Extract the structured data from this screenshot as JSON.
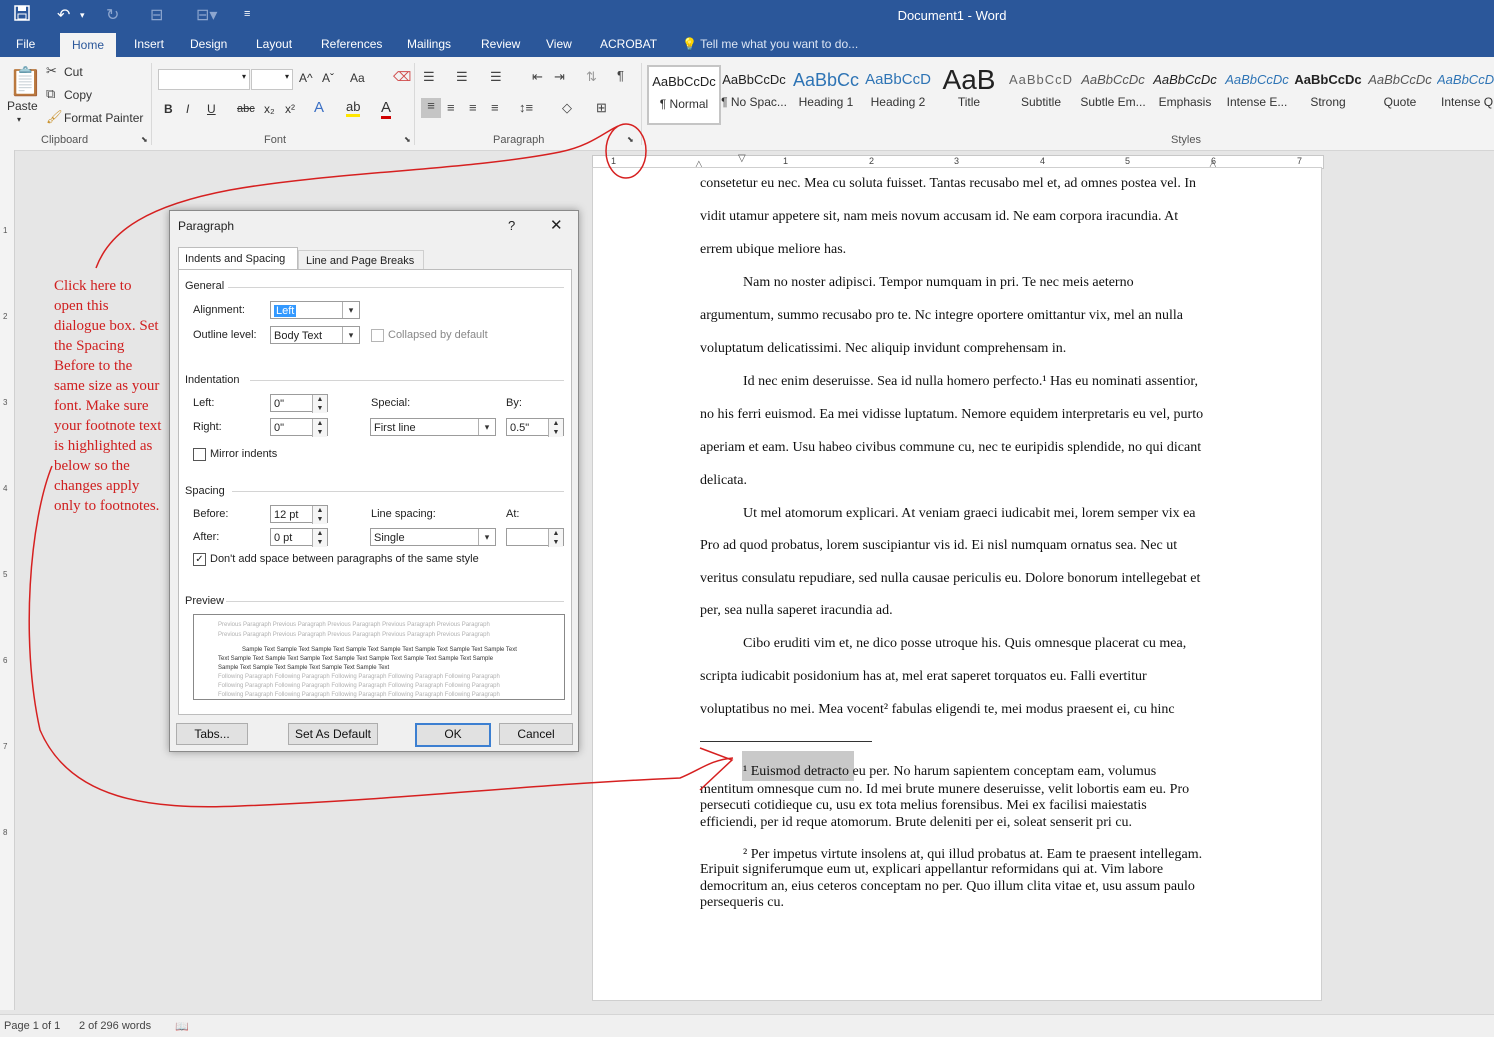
{
  "window": {
    "title": "Document1 - Word",
    "qat_icons": [
      "save-icon",
      "undo-icon",
      "redo-icon",
      "customize-qat-icon"
    ]
  },
  "ribbon_tabs": [
    "File",
    "Home",
    "Insert",
    "Design",
    "Layout",
    "References",
    "Mailings",
    "Review",
    "View",
    "ACROBAT"
  ],
  "active_tab": "Home",
  "tell_me": "Tell me what you want to do...",
  "clipboard": {
    "paste": "Paste",
    "cut": "Cut",
    "copy": "Copy",
    "format_painter": "Format Painter",
    "label": "Clipboard"
  },
  "font_group": {
    "font_name": "",
    "font_size": "",
    "label": "Font",
    "bold": "B",
    "italic": "I",
    "underline": "U",
    "strike": "abc",
    "subscript": "x₂",
    "superscript": "x²",
    "grow": "A^",
    "shrink": "Aˇ",
    "change_case": "Aa"
  },
  "paragraph_group": {
    "label": "Paragraph"
  },
  "styles_group": {
    "label": "Styles",
    "items": [
      {
        "preview": "AaBbCcDc",
        "name": "¶ Normal"
      },
      {
        "preview": "AaBbCcDc",
        "name": "¶ No Spac..."
      },
      {
        "preview": "AaBbCc",
        "name": "Heading 1"
      },
      {
        "preview": "AaBbCcD",
        "name": "Heading 2"
      },
      {
        "preview": "AaB",
        "name": "Title"
      },
      {
        "preview": "AaBbCcD",
        "name": "Subtitle"
      },
      {
        "preview": "AaBbCcDc",
        "name": "Subtle Em..."
      },
      {
        "preview": "AaBbCcDc",
        "name": "Emphasis"
      },
      {
        "preview": "AaBbCcDc",
        "name": "Intense E..."
      },
      {
        "preview": "AaBbCcDc",
        "name": "Strong"
      },
      {
        "preview": "AaBbCcDc",
        "name": "Quote"
      },
      {
        "preview": "AaBbCcDc",
        "name": "Intense Q..."
      }
    ]
  },
  "ruler": {
    "labels": [
      "1",
      "1",
      "2",
      "3",
      "4",
      "5",
      "6",
      "7"
    ]
  },
  "vertical_ruler": {
    "labels": [
      "1",
      "2",
      "3",
      "4",
      "5",
      "6",
      "7",
      "8"
    ]
  },
  "document": {
    "body_lines": [
      "consetetur eu nec. Mea cu soluta fuisset. Tantas recusabo mel et, ad omnes postea vel. In",
      "vidit utamur appetere sit, nam meis novum accusam id. Ne eam corpora iracundia. At",
      "errem ubique meliore has.",
      "Nam no noster adipisci. Tempor numquam in pri. Te nec meis aeterno",
      "argumentum, summo recusabo pro te. Nc integre oportere omittantur vix, mel an nulla",
      "voluptatum delicatissimi. Nec aliquip invidunt comprehensam in.",
      "Id nec enim deseruisse. Sea id nulla homero perfecto.¹ Has eu nominati assentior,",
      "no his ferri euismod. Ea mei vidisse luptatum. Nemore equidem interpretaris eu vel, purto",
      "aperiam et eam. Usu habeo civibus commune cu, nec te euripidis splendide, no qui dicant",
      "delicata.",
      "Ut mel atomorum explicari. At veniam graeci iudicabit mei, lorem semper vix ea",
      "Pro ad quod probatus, lorem suscipiantur vis id. Ei nisl numquam ornatus sea. Nec ut",
      "veritus consulatu repudiare, sed nulla causae periculis eu. Dolore bonorum intellegebat et",
      "per, sea nulla saperet iracundia ad.",
      "Cibo eruditi vim et, ne dico posse utroque his. Quis omnesque placerat cu mea,",
      "scripta iudicabit posidonium has at, mel erat saperet torquatos eu. Falli evertitur",
      "voluptatibus no mei. Mea vocent² fabulas eligendi te, mei modus praesent ei, cu hinc"
    ],
    "footnote1_lines": [
      "¹ Euismod detracto eu per. No harum sapientem conceptam eam, volumus",
      "mentitum omnesque cum no. Id mei brute munere deseruisse, velit lobortis eam eu. Pro",
      "persecuti cotidieque cu, usu ex tota melius forensibus. Mei ex facilisi maiestatis",
      "efficiendi, per id reque atomorum. Brute deleniti per ei, soleat senserit pri cu."
    ],
    "footnote2_lines": [
      "² Per impetus virtute insolens at, qui illud probatus at. Eam te praesent intellegam.",
      "Eripuit signiferumque eum ut, explicari appellantur reformidans qui at. Vim labore",
      "democritum an, eius ceteros conceptam no per. Quo illum clita vitae et, usu assum paulo",
      "persequeris cu."
    ]
  },
  "annotation": {
    "lines": [
      "Click here to",
      "open this",
      "dialogue box. Set",
      "the Spacing",
      "Before to the",
      "same size as your",
      "font. Make sure",
      "your footnote text",
      "is highlighted as",
      "below so the",
      "changes apply",
      "only to footnotes."
    ],
    "color": "#d02020"
  },
  "dialog": {
    "title": "Paragraph",
    "help": "?",
    "close": "✕",
    "tabs": [
      "Indents and Spacing",
      "Line and Page Breaks"
    ],
    "general": {
      "heading": "General",
      "alignment_label": "Alignment:",
      "alignment_value": "Left",
      "outline_label": "Outline level:",
      "outline_value": "Body Text",
      "collapsed_label": "Collapsed by default",
      "collapsed_checked": false
    },
    "indentation": {
      "heading": "Indentation",
      "left_label": "Left:",
      "left_value": "0\"",
      "right_label": "Right:",
      "right_value": "0\"",
      "special_label": "Special:",
      "special_value": "First line",
      "by_label": "By:",
      "by_value": "0.5\"",
      "mirror_label": "Mirror indents",
      "mirror_checked": false
    },
    "spacing": {
      "heading": "Spacing",
      "before_label": "Before:",
      "before_value": "12 pt",
      "after_label": "After:",
      "after_value": "0 pt",
      "line_spacing_label": "Line spacing:",
      "line_spacing_value": "Single",
      "at_label": "At:",
      "at_value": "",
      "dont_add_label": "Don't add space between paragraphs of the same style",
      "dont_add_checked": true
    },
    "preview": {
      "heading": "Preview",
      "prev_lines": [
        "Previous Paragraph Previous Paragraph Previous Paragraph Previous Paragraph Previous Paragraph",
        "Previous Paragraph Previous Paragraph Previous Paragraph Previous Paragraph Previous Paragraph"
      ],
      "sample_lines": [
        "Sample Text Sample Text Sample Text Sample Text Sample Text Sample Text Sample Text Sample Text",
        "Text Sample Text Sample Text Sample Text Sample Text Sample Text Sample Text Sample Text Sample",
        "Sample Text Sample Text Sample Text Sample Text Sample Text"
      ],
      "follow_lines": [
        "Following Paragraph Following Paragraph Following Paragraph Following Paragraph Following Paragraph",
        "Following Paragraph Following Paragraph Following Paragraph Following Paragraph Following Paragraph",
        "Following Paragraph Following Paragraph Following Paragraph Following Paragraph Following Paragraph"
      ]
    },
    "buttons": {
      "tabs": "Tabs...",
      "set_default": "Set As Default",
      "ok": "OK",
      "cancel": "Cancel"
    }
  },
  "status": {
    "page": "Page 1 of 1",
    "words": "2 of 296 words"
  }
}
